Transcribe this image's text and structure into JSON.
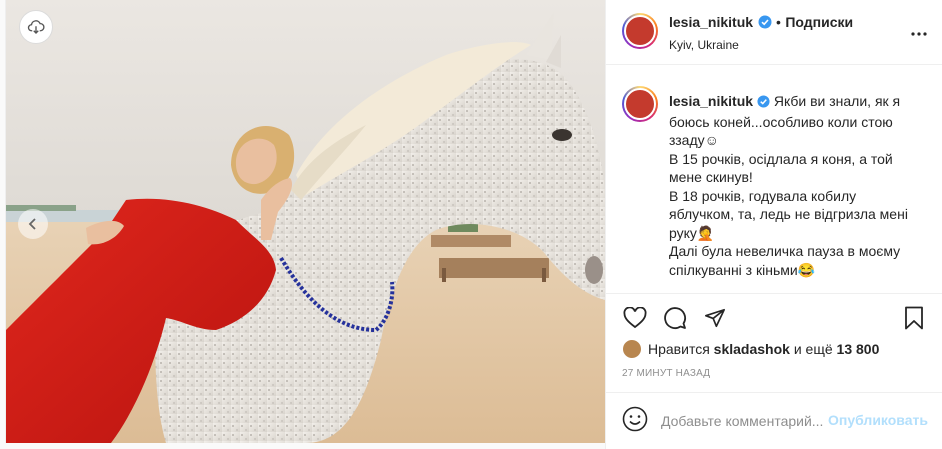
{
  "post": {
    "username": "lesia_nikituk",
    "separator": "•",
    "follow_label": "Подписки",
    "location": "Kyiv, Ukraine"
  },
  "caption": {
    "username": "lesia_nikituk",
    "lines": [
      "Якби ви знали, як я",
      "боюсь коней...особливо коли стою",
      "ззаду☺",
      "В 15 рочків, осідлала я коня, а той",
      "мене скинув!",
      "В 18 рочків, годувала кобилу",
      "яблучком, та, ледь не відгризла мені",
      "руку🤦",
      "Далі була невеличка пауза в моєму",
      "спілкуванні з кіньми😂"
    ]
  },
  "likes": {
    "prefix": "Нравится",
    "user": "skladashok",
    "middle": "и ещё",
    "count": "13 800"
  },
  "timestamp": "27 МИНУТ НАЗАД",
  "comment": {
    "placeholder": "Добавьте комментарий...",
    "publish_label": "Опубликовать"
  },
  "icons": {
    "save_to_cloud": "cloud-download-icon",
    "prev": "chevron-left-icon",
    "verified": "verified-badge-icon",
    "more": "ellipsis-icon",
    "like": "heart-icon",
    "comment": "comment-bubble-icon",
    "share": "paper-plane-icon",
    "save": "bookmark-icon",
    "emoji": "emoji-smile-icon"
  },
  "colors": {
    "verified": "#3897f0",
    "publish_disabled": "#b2dffc",
    "muted_text": "#8e8e8e",
    "divider": "#efefef"
  }
}
